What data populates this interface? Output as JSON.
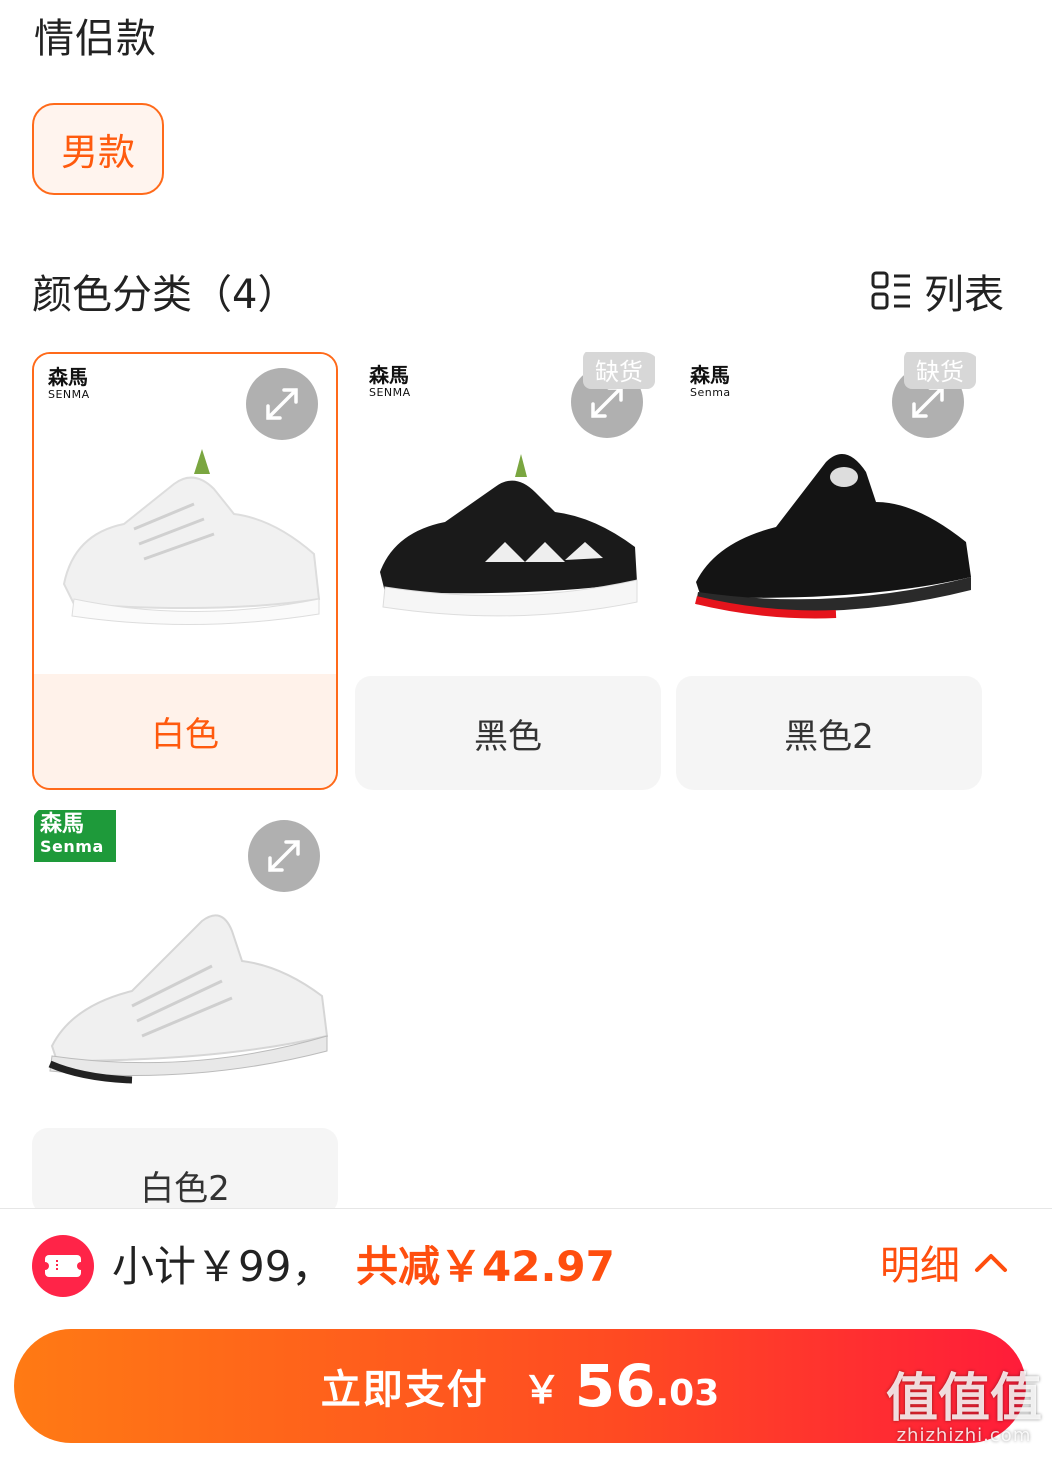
{
  "section": {
    "title": "情侣款"
  },
  "style_option": {
    "label": "男款"
  },
  "color_section": {
    "title": "颜色分类（4）",
    "view_toggle_label": "列表"
  },
  "colors": [
    {
      "label": "白色",
      "brand": "森馬",
      "brand_sub": "SENMA",
      "selected": true,
      "out_of_stock": false
    },
    {
      "label": "黑色",
      "brand": "森馬",
      "brand_sub": "SENMA",
      "selected": false,
      "out_of_stock": true,
      "badge": "缺货"
    },
    {
      "label": "黑色2",
      "brand": "森馬",
      "brand_sub": "Senma",
      "selected": false,
      "out_of_stock": true,
      "badge": "缺货"
    },
    {
      "label": "白色2",
      "brand": "森馬",
      "brand_sub": "Senma",
      "selected": false,
      "out_of_stock": false
    }
  ],
  "summary": {
    "subtotal": "小计￥99，",
    "discount": "共减￥42.97",
    "detail_label": "明细"
  },
  "pay": {
    "label": "立即支付",
    "currency": "￥",
    "amount_int": "56",
    "amount_dec": ".03"
  },
  "watermark": {
    "logo": "值值值",
    "domain": "zhizhizhi.com"
  },
  "theme": {
    "accent": "#ff5a0e",
    "pay_gradient": [
      "#ff7a14",
      "#ff1c3a"
    ],
    "badge_bg": "#d7d7d7"
  }
}
